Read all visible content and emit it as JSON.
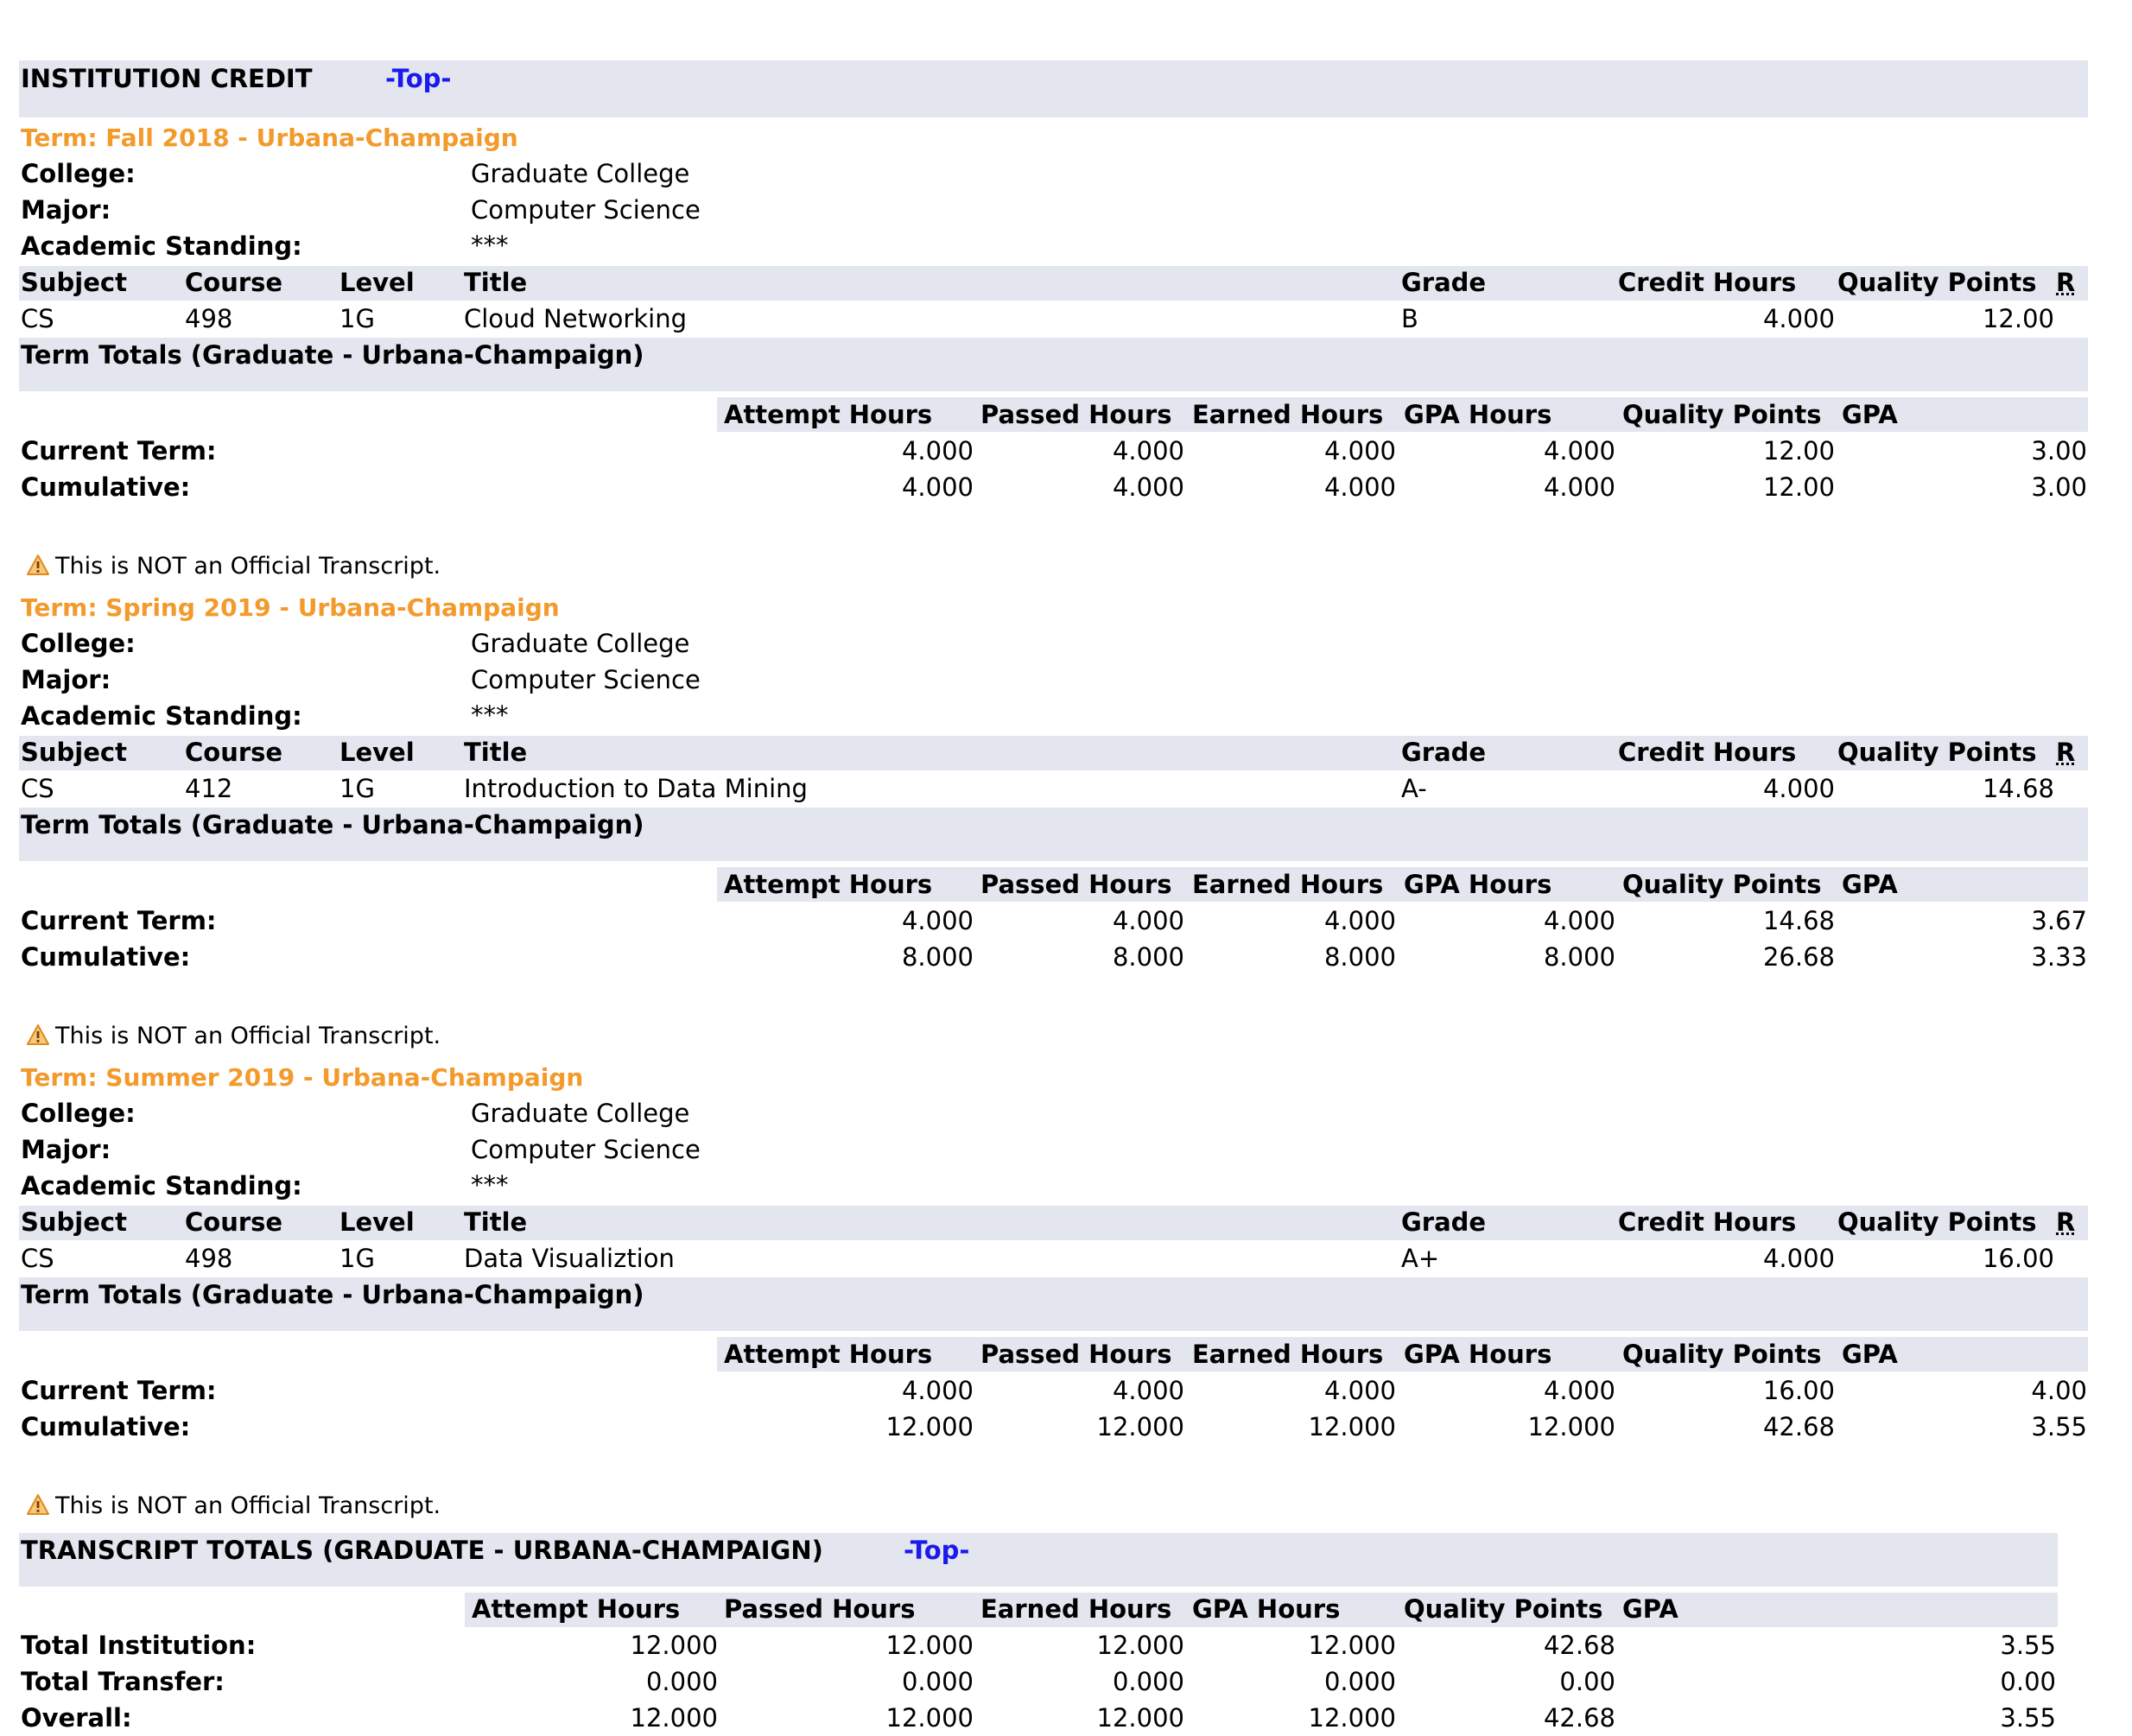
{
  "header": {
    "title": "INSTITUTION CREDIT",
    "top_link": "-Top-"
  },
  "labels": {
    "college": "College:",
    "major": "Major:",
    "standing": "Academic Standing:",
    "course_headers": [
      "Subject",
      "Course",
      "Level",
      "Title",
      "Grade",
      "Credit Hours",
      "Quality Points",
      "R"
    ],
    "term_totals_title": "Term Totals (Graduate - Urbana-Champaign)",
    "totals_headers": [
      "Attempt Hours",
      "Passed Hours",
      "Earned Hours",
      "GPA Hours",
      "Quality Points",
      "GPA"
    ],
    "current_term": "Current Term:",
    "cumulative": "Cumulative:",
    "warning": "This is NOT an Official Transcript."
  },
  "terms": [
    {
      "term": "Term: Fall 2018 - Urbana-Champaign",
      "college": "Graduate College",
      "major": "Computer Science",
      "standing": "***",
      "course": {
        "subject": "CS",
        "number": "498",
        "level": "1G",
        "title": "Cloud Networking",
        "grade": "B",
        "credit_hours": "4.000",
        "quality_points": "12.00"
      },
      "current": [
        "4.000",
        "4.000",
        "4.000",
        "4.000",
        "12.00",
        "3.00"
      ],
      "cumulative": [
        "4.000",
        "4.000",
        "4.000",
        "4.000",
        "12.00",
        "3.00"
      ]
    },
    {
      "term": "Term: Spring 2019 - Urbana-Champaign",
      "college": "Graduate College",
      "major": "Computer Science",
      "standing": "***",
      "course": {
        "subject": "CS",
        "number": "412",
        "level": "1G",
        "title": "Introduction to Data Mining",
        "grade": "A-",
        "credit_hours": "4.000",
        "quality_points": "14.68"
      },
      "current": [
        "4.000",
        "4.000",
        "4.000",
        "4.000",
        "14.68",
        "3.67"
      ],
      "cumulative": [
        "8.000",
        "8.000",
        "8.000",
        "8.000",
        "26.68",
        "3.33"
      ]
    },
    {
      "term": "Term: Summer 2019 - Urbana-Champaign",
      "college": "Graduate College",
      "major": "Computer Science",
      "standing": "***",
      "course": {
        "subject": "CS",
        "number": "498",
        "level": "1G",
        "title": "Data Visualiztion",
        "grade": "A+",
        "credit_hours": "4.000",
        "quality_points": "16.00"
      },
      "current": [
        "4.000",
        "4.000",
        "4.000",
        "4.000",
        "16.00",
        "4.00"
      ],
      "cumulative": [
        "12.000",
        "12.000",
        "12.000",
        "12.000",
        "42.68",
        "3.55"
      ]
    }
  ],
  "transcript_totals": {
    "title": "TRANSCRIPT TOTALS (GRADUATE - URBANA-CHAMPAIGN)",
    "top_link": "-Top-",
    "headers": [
      "Attempt Hours",
      "Passed Hours",
      "Earned Hours",
      "GPA Hours",
      "Quality Points",
      "GPA"
    ],
    "rows": [
      {
        "label": "Total Institution:",
        "values": [
          "12.000",
          "12.000",
          "12.000",
          "12.000",
          "42.68",
          "3.55"
        ]
      },
      {
        "label": "Total Transfer:",
        "values": [
          "0.000",
          "0.000",
          "0.000",
          "0.000",
          "0.00",
          "0.00"
        ]
      },
      {
        "label": "Overall:",
        "values": [
          "12.000",
          "12.000",
          "12.000",
          "12.000",
          "42.68",
          "3.55"
        ]
      }
    ]
  },
  "colors": {
    "band": "#e3e5ef",
    "term_orange": "#f39a2b",
    "link_blue": "#1a1aee",
    "warning_icon": "#f39a2b"
  },
  "icons": {
    "warning": "warning-triangle-icon"
  }
}
